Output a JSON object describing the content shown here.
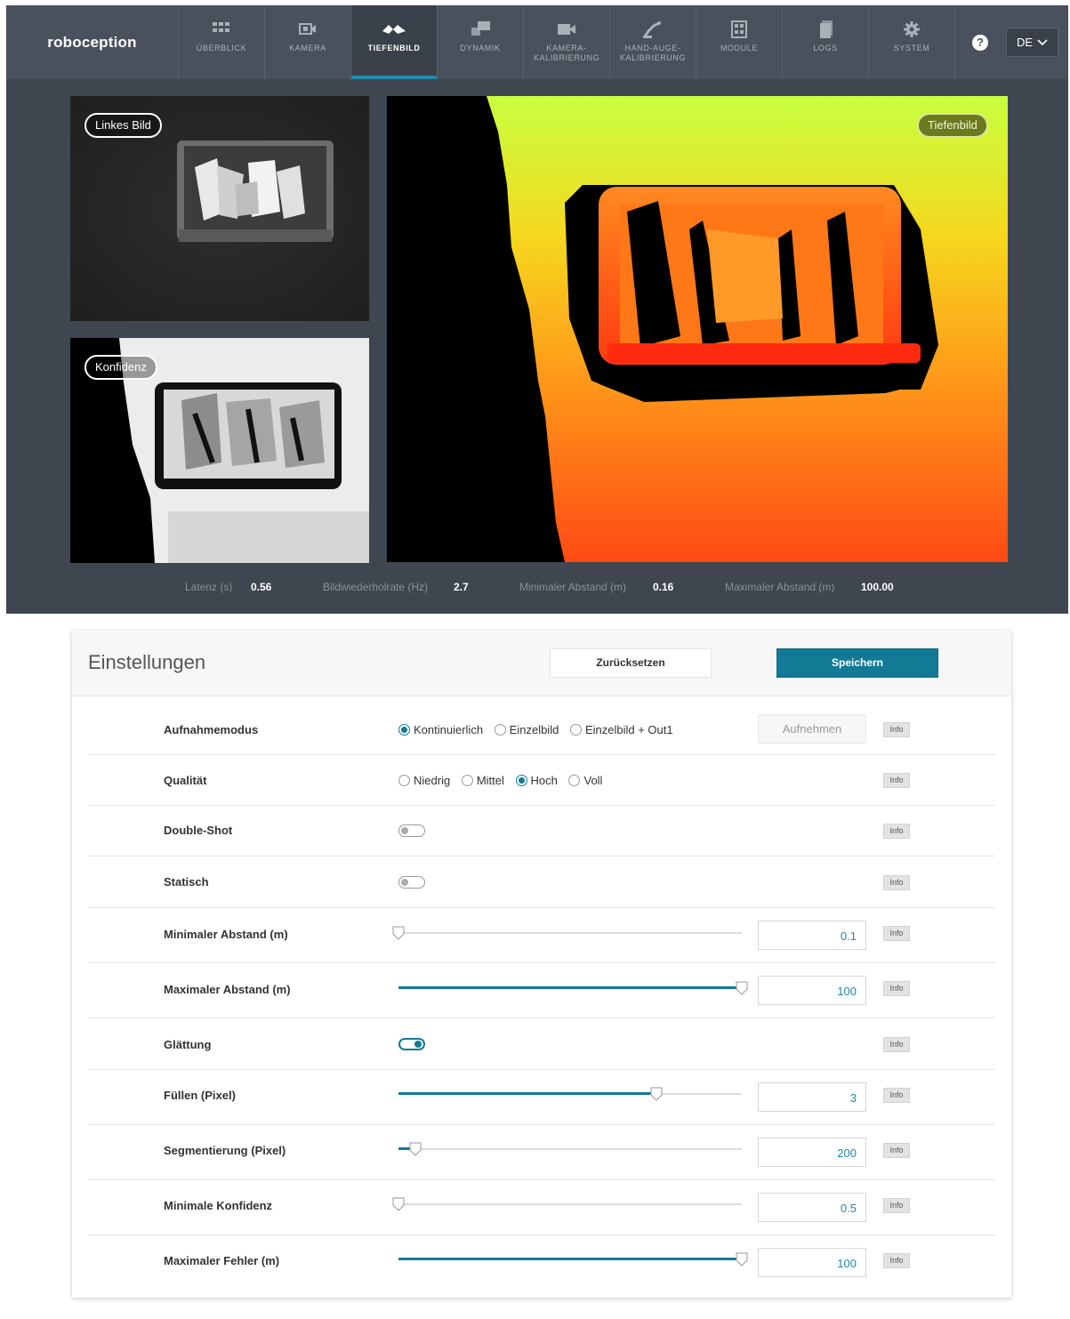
{
  "brand": "roboception",
  "nav": [
    {
      "label": "ÜBERBLICK",
      "icon": "grid-icon"
    },
    {
      "label": "KAMERA",
      "icon": "camera-icon"
    },
    {
      "label": "TIEFENBILD",
      "icon": "depth-icon"
    },
    {
      "label": "DYNAMIK",
      "icon": "dynamics-icon"
    },
    {
      "label": "KAMERA-\nKALIBRIERUNG",
      "icon": "video-icon"
    },
    {
      "label": "HAND-AUGE-\nKALIBRIERUNG",
      "icon": "robot-arm-icon"
    },
    {
      "label": "MODULE",
      "icon": "modules-icon"
    },
    {
      "label": "LOGS",
      "icon": "document-icon"
    },
    {
      "label": "SYSTEM",
      "icon": "gear-icon"
    }
  ],
  "help_icon": "?",
  "language": "DE",
  "images": {
    "left_tag": "Linkes Bild",
    "confidence_tag": "Konfidenz",
    "depth_tag": "Tiefenbild"
  },
  "stats": [
    {
      "label": "Latenz (s)",
      "value": "0.56"
    },
    {
      "label": "Bildwiederholrate (Hz)",
      "value": "2.7"
    },
    {
      "label": "Minimaler Abstand (m)",
      "value": "0.16"
    },
    {
      "label": "Maximaler Abstand (m)",
      "value": "100.00"
    }
  ],
  "settings": {
    "title": "Einstellungen",
    "reset_label": "Zurücksetzen",
    "save_label": "Speichern",
    "info_label": "Info",
    "acquisition": {
      "label": "Aufnahmemodus",
      "options": [
        "Kontinuierlich",
        "Einzelbild",
        "Einzelbild + Out1"
      ],
      "selected": "Kontinuierlich",
      "capture_label": "Aufnehmen"
    },
    "quality": {
      "label": "Qualität",
      "options": [
        "Niedrig",
        "Mittel",
        "Hoch",
        "Voll"
      ],
      "selected": "Hoch"
    },
    "double_shot": {
      "label": "Double-Shot",
      "on": false
    },
    "static": {
      "label": "Statisch",
      "on": false
    },
    "min_distance": {
      "label": "Minimaler Abstand (m)",
      "value": "0.1",
      "fraction": 0.0
    },
    "max_distance": {
      "label": "Maximaler Abstand (m)",
      "value": "100",
      "fraction": 1.0
    },
    "smoothing": {
      "label": "Glättung",
      "on": true
    },
    "fill": {
      "label": "Füllen (Pixel)",
      "value": "3",
      "fraction": 0.75
    },
    "segmentation": {
      "label": "Segmentierung (Pixel)",
      "value": "200",
      "fraction": 0.05
    },
    "min_confidence": {
      "label": "Minimale Konfidenz",
      "value": "0.5",
      "fraction": 0.0
    },
    "max_error": {
      "label": "Maximaler Fehler (m)",
      "value": "100",
      "fraction": 1.0
    }
  }
}
